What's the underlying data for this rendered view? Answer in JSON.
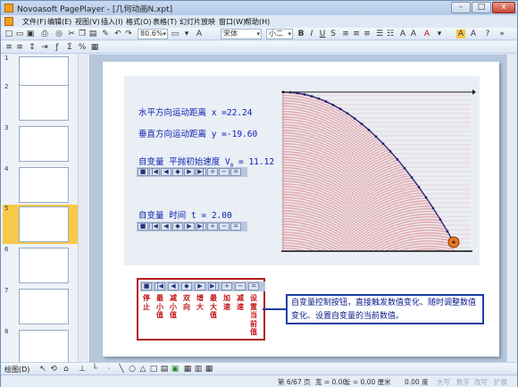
{
  "window": {
    "title": "Novoasoft PagePlayer - [几何动画N.xpt]",
    "controls": {
      "minimize": "–",
      "maximize": "□",
      "close": "x"
    }
  },
  "menu": [
    "文件(F)",
    "编辑(E)",
    "视图(V)",
    "插入(I)",
    "格式(O)",
    "表格(T)",
    "幻灯片放映",
    "窗口(W)",
    "帮助(H)"
  ],
  "toolbar": {
    "zoom_value": "80.6%",
    "font_name": "宋体",
    "font_size": "小二",
    "bold": "B",
    "italic": "I",
    "underline": "U",
    "shadow": "S",
    "text_color": "A",
    "sigma": "Σ",
    "percent": "%"
  },
  "sidebar": {
    "slides": [
      {
        "num": "1"
      },
      {
        "num": "2"
      },
      {
        "num": "3"
      },
      {
        "num": "4"
      },
      {
        "num": "5",
        "selected": true
      },
      {
        "num": "6"
      },
      {
        "num": "7"
      },
      {
        "num": "8"
      }
    ]
  },
  "slide": {
    "line1": "水平方向运动距离 x =22.24",
    "line2": "垂直方向运动距离 y =-19.60",
    "line3": "自变量  平抛初始速度 V",
    "line3_sub": "0",
    "line3_value": " = 11.12",
    "line4": "自变量  时间 t = 2.00",
    "ctrl_glyphs": [
      "■",
      "|◀",
      "◀",
      "◆",
      "▶",
      "▶|",
      "+",
      "−",
      "="
    ],
    "legend_labels": [
      [
        "停",
        "止"
      ],
      [
        "最",
        "小",
        "值"
      ],
      [
        "减",
        "小",
        "值"
      ],
      [
        "双",
        "向"
      ],
      [
        "增",
        "大"
      ],
      [
        "最",
        "大",
        "值"
      ],
      [
        "加",
        "速"
      ],
      [
        "减",
        "速"
      ],
      [
        "设",
        "置",
        "当",
        "前",
        "值"
      ]
    ],
    "callout": "自变量控制按钮，直接触发数值变化、随时调整数值变化、设置自变量的当前数值。"
  },
  "drawbar": {
    "label": "绘图(D)"
  },
  "status": {
    "slide": "第 6/67 页",
    "w": "宽 = 0.00,",
    "h": "长 = 0.00 厘米",
    "depth": "0.00 度",
    "caps": "大写",
    "num": "数字",
    "ins": "改写",
    "ext": "扩展"
  },
  "colors": {
    "accent_red": "#c41212",
    "text_blue": "#0a1fb0",
    "callout_border": "#1a3ea8"
  }
}
